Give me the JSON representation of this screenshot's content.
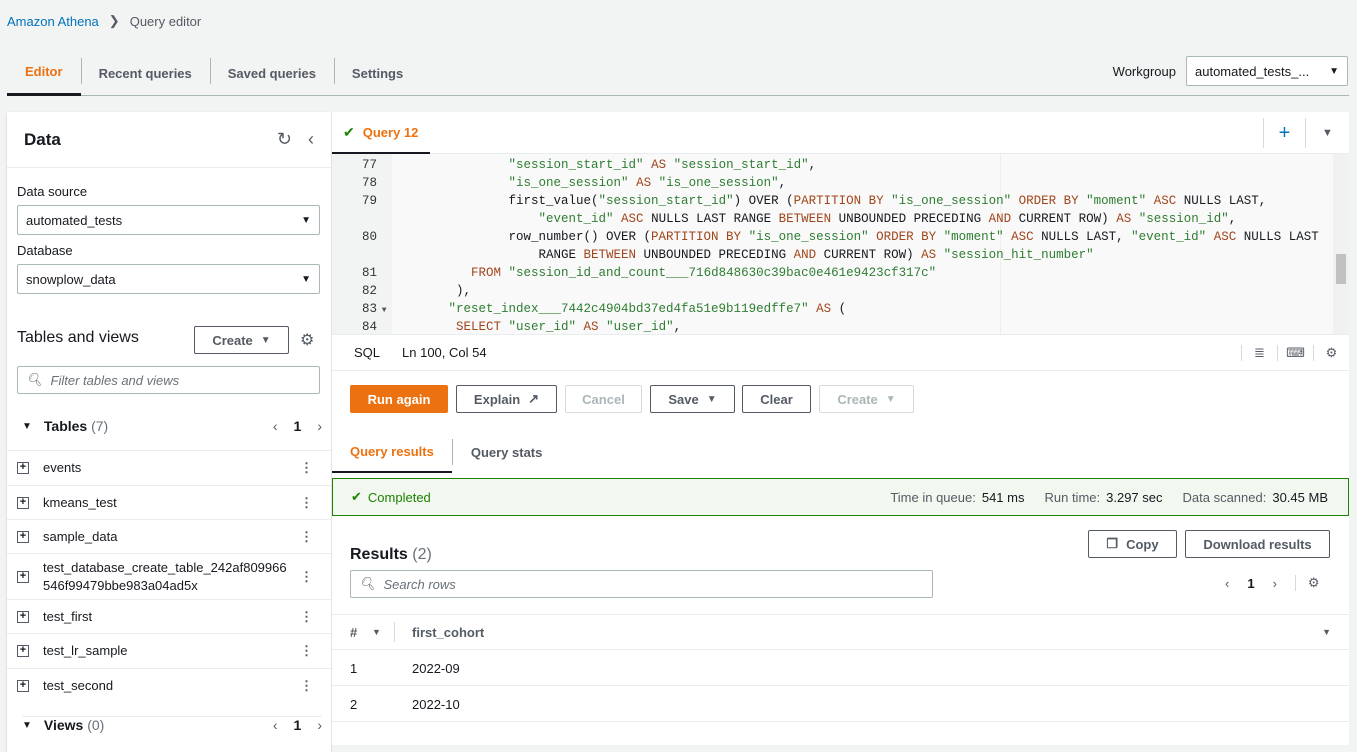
{
  "breadcrumb": {
    "root": "Amazon Athena",
    "current": "Query editor"
  },
  "tabs": [
    {
      "label": "Editor",
      "active": true
    },
    {
      "label": "Recent queries"
    },
    {
      "label": "Saved queries"
    },
    {
      "label": "Settings"
    }
  ],
  "workgroup": {
    "label": "Workgroup",
    "value": "automated_tests_..."
  },
  "data_panel": {
    "title": "Data",
    "data_source_label": "Data source",
    "data_source": "automated_tests",
    "database_label": "Database",
    "database": "snowplow_data",
    "tables_views_title": "Tables and views",
    "create_label": "Create",
    "filter_placeholder": "Filter tables and views",
    "tables_label": "Tables",
    "tables_count": "(7)",
    "page": "1",
    "tables": [
      "events",
      "kmeans_test",
      "sample_data",
      "test_database_create_table_242af809966 546f99479bbe983a04ad5x",
      "test_first",
      "test_lr_sample",
      "test_second"
    ],
    "views_label": "Views",
    "views_count": "(0)",
    "views_page": "1"
  },
  "query_tab": {
    "label": "Query 12",
    "status": "success"
  },
  "code_lines": [
    {
      "n": "77",
      "tokens": [
        [
          "               ",
          ""
        ],
        [
          "\"session_start_id\"",
          "str"
        ],
        [
          " AS ",
          "kw"
        ],
        [
          "\"session_start_id\"",
          "str"
        ],
        [
          ",",
          ""
        ]
      ]
    },
    {
      "n": "78",
      "tokens": [
        [
          "               ",
          ""
        ],
        [
          "\"is_one_session\"",
          "str"
        ],
        [
          " AS ",
          "kw"
        ],
        [
          "\"is_one_session\"",
          "str"
        ],
        [
          ",",
          ""
        ]
      ]
    },
    {
      "n": "79",
      "tokens": [
        [
          "               first_value(",
          ""
        ],
        [
          "\"session_start_id\"",
          "str"
        ],
        [
          ") OVER (",
          ""
        ],
        [
          "PARTITION BY ",
          "kw"
        ],
        [
          "\"is_one_session\"",
          "str"
        ],
        [
          " ORDER BY ",
          "kw"
        ],
        [
          "\"moment\"",
          "str"
        ],
        [
          " ASC ",
          "kw"
        ],
        [
          "NULLS LAST,",
          ""
        ]
      ]
    },
    {
      "n": "",
      "tokens": [
        [
          "                   ",
          ""
        ],
        [
          "\"event_id\"",
          "str"
        ],
        [
          " ASC ",
          "kw"
        ],
        [
          "NULLS LAST RANGE ",
          ""
        ],
        [
          "BETWEEN ",
          "kw"
        ],
        [
          "UNBOUNDED PRECEDING ",
          ""
        ],
        [
          "AND ",
          "kw"
        ],
        [
          "CURRENT ROW) ",
          ""
        ],
        [
          "AS ",
          "kw"
        ],
        [
          "\"session_id\"",
          "str"
        ],
        [
          ",",
          ""
        ]
      ]
    },
    {
      "n": "80",
      "tokens": [
        [
          "               row_number() OVER (",
          ""
        ],
        [
          "PARTITION BY ",
          "kw"
        ],
        [
          "\"is_one_session\"",
          "str"
        ],
        [
          " ORDER BY ",
          "kw"
        ],
        [
          "\"moment\"",
          "str"
        ],
        [
          " ASC ",
          "kw"
        ],
        [
          "NULLS LAST, ",
          ""
        ],
        [
          "\"event_id\"",
          "str"
        ],
        [
          " ASC ",
          "kw"
        ],
        [
          "NULLS LAST",
          ""
        ]
      ]
    },
    {
      "n": "",
      "tokens": [
        [
          "                   RANGE ",
          ""
        ],
        [
          "BETWEEN ",
          "kw"
        ],
        [
          "UNBOUNDED PRECEDING ",
          ""
        ],
        [
          "AND ",
          "kw"
        ],
        [
          "CURRENT ROW) ",
          ""
        ],
        [
          "AS ",
          "kw"
        ],
        [
          "\"session_hit_number\"",
          "str"
        ]
      ]
    },
    {
      "n": "81",
      "tokens": [
        [
          "          ",
          ""
        ],
        [
          "FROM ",
          "kw"
        ],
        [
          "\"session_id_and_count___716d848630c39bac0e461e9423cf317c\"",
          "str"
        ]
      ]
    },
    {
      "n": "82",
      "tokens": [
        [
          "        ),",
          ""
        ]
      ]
    },
    {
      "n": "83",
      "fold": true,
      "tokens": [
        [
          "       ",
          ""
        ],
        [
          "\"reset_index___7442c4904bd37ed4fa51e9b119edffe7\"",
          "str"
        ],
        [
          " AS ",
          "kw"
        ],
        [
          "(",
          ""
        ]
      ]
    },
    {
      "n": "84",
      "tokens": [
        [
          "        ",
          ""
        ],
        [
          "SELECT ",
          "kw"
        ],
        [
          "\"user_id\"",
          "str"
        ],
        [
          " AS ",
          "kw"
        ],
        [
          "\"user_id\"",
          "str"
        ],
        [
          ",",
          ""
        ]
      ]
    }
  ],
  "status_bar": {
    "language": "SQL",
    "position": "Ln 100, Col 54"
  },
  "actions": {
    "run": "Run again",
    "explain": "Explain",
    "cancel": "Cancel",
    "save": "Save",
    "clear": "Clear",
    "create": "Create"
  },
  "result_tabs": [
    {
      "label": "Query results",
      "active": true
    },
    {
      "label": "Query stats"
    }
  ],
  "completion": {
    "status": "Completed",
    "time_in_queue_label": "Time in queue:",
    "time_in_queue": "541 ms",
    "run_time_label": "Run time:",
    "run_time": "3.297 sec",
    "data_scanned_label": "Data scanned:",
    "data_scanned": "30.45 MB"
  },
  "results": {
    "title": "Results",
    "count": "(2)",
    "copy": "Copy",
    "download": "Download results",
    "search_placeholder": "Search rows",
    "page": "1",
    "columns": [
      "#",
      "first_cohort"
    ],
    "rows": [
      [
        "1",
        "2022-09"
      ],
      [
        "2",
        "2022-10"
      ]
    ]
  },
  "colors": {
    "accent": "#ec7211",
    "success": "#1d8102",
    "link": "#0073bb"
  }
}
